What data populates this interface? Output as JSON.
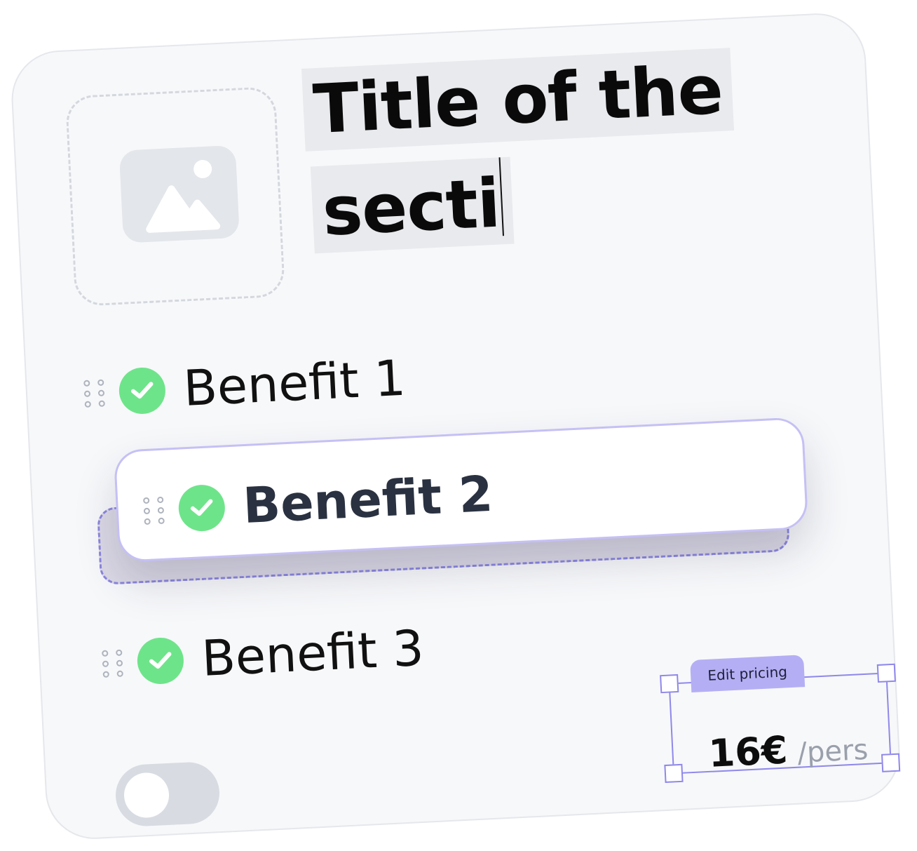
{
  "section": {
    "title_line1": "Title of the",
    "title_line2": "secti"
  },
  "benefits": [
    {
      "label": "Benefit 1"
    },
    {
      "label": "Benefit 2"
    },
    {
      "label": "Benefit 3"
    }
  ],
  "pricing": {
    "tab_label": "Edit pricing",
    "amount": "16€",
    "unit": "/pers"
  },
  "toggle": {
    "on": false
  },
  "colors": {
    "check_green": "#6ee48a",
    "accent_purple": "#8f88ea",
    "card_bg": "#f7f8fa"
  }
}
